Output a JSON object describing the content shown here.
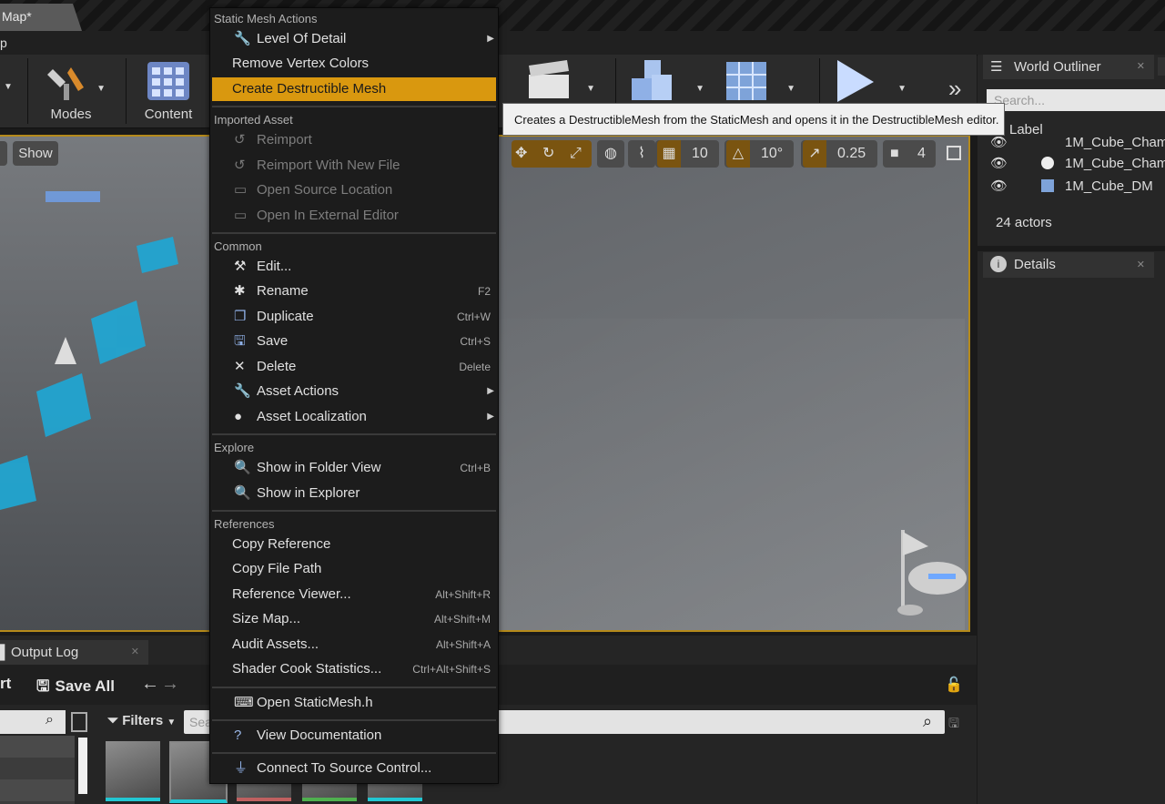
{
  "window": {
    "tab_title": "Map*",
    "menubar_fragment": "p"
  },
  "toolbar": {
    "modes_label": "Modes",
    "content_label": "Content"
  },
  "viewport": {
    "show_label": "Show",
    "grid_value": "10",
    "rotation_value": "10°",
    "scale_value": "0.25",
    "camera_speed": "4"
  },
  "outliner": {
    "title": "World Outliner",
    "search_placeholder": "Search...",
    "column_label": "Label",
    "rows": [
      "1M_Cube_Cham",
      "1M_Cube_Cham",
      "1M_Cube_DM"
    ],
    "actors_count": "24 actors"
  },
  "details": {
    "title": "Details"
  },
  "bottom": {
    "output_log": "Output Log",
    "import_fragment": "rt",
    "save_all": "Save All",
    "filters": "Filters",
    "search_placeholder": "Sea"
  },
  "menu": {
    "section_static": "Static Mesh Actions",
    "level_of_detail": "Level Of Detail",
    "remove_vertex_colors": "Remove Vertex Colors",
    "create_destructible": "Create Destructible Mesh",
    "section_imported": "Imported Asset",
    "reimport": "Reimport",
    "reimport_new": "Reimport With New File",
    "open_source_location": "Open Source Location",
    "open_external": "Open In External Editor",
    "section_common": "Common",
    "edit": "Edit...",
    "rename": "Rename",
    "rename_sc": "F2",
    "duplicate": "Duplicate",
    "duplicate_sc": "Ctrl+W",
    "save": "Save",
    "save_sc": "Ctrl+S",
    "delete": "Delete",
    "delete_sc": "Delete",
    "asset_actions": "Asset Actions",
    "asset_localization": "Asset Localization",
    "section_explore": "Explore",
    "show_folder": "Show in Folder View",
    "show_folder_sc": "Ctrl+B",
    "show_explorer": "Show in Explorer",
    "section_references": "References",
    "copy_reference": "Copy Reference",
    "copy_file_path": "Copy File Path",
    "reference_viewer": "Reference Viewer...",
    "reference_viewer_sc": "Alt+Shift+R",
    "size_map": "Size Map...",
    "size_map_sc": "Alt+Shift+M",
    "audit_assets": "Audit Assets...",
    "audit_assets_sc": "Alt+Shift+A",
    "shader_cook": "Shader Cook Statistics...",
    "shader_cook_sc": "Ctrl+Alt+Shift+S",
    "open_staticmesh_h": "Open StaticMesh.h",
    "view_documentation": "View Documentation",
    "connect_source_control": "Connect To Source Control..."
  },
  "tooltip": "Creates a DestructibleMesh from the StaticMesh and opens it in the DestructibleMesh editor.",
  "colors": {
    "highlight": "#d9980f",
    "accent_cyan": "#22c7d3",
    "viewport_border": "#b58a1a"
  }
}
